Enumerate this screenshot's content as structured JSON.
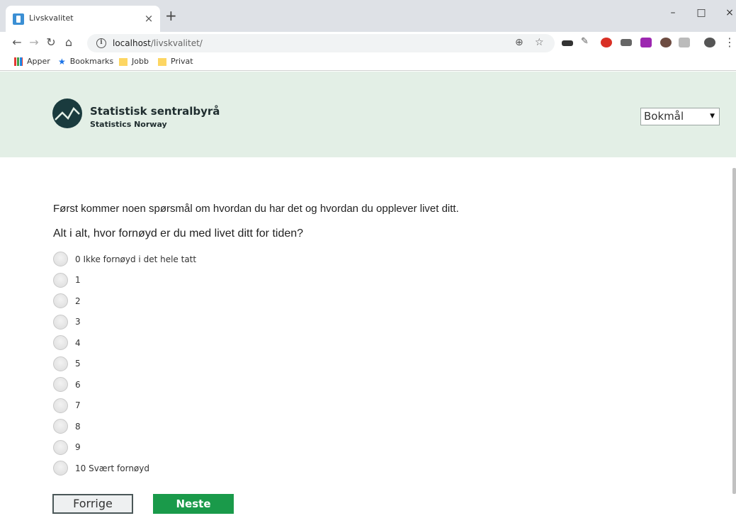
{
  "browser": {
    "tab_title": "Livskvalitet",
    "tab_close": "×",
    "new_tab": "+",
    "url_host": "localhost",
    "url_path": "/livskvalitet/",
    "window": {
      "minimize": "–",
      "maximize": "□",
      "close": "×"
    }
  },
  "bookmarks": [
    {
      "label": "Apper",
      "icon": "apps-grid-icon"
    },
    {
      "label": "Bookmarks",
      "icon": "star-icon"
    },
    {
      "label": "Jobb",
      "icon": "folder-icon"
    },
    {
      "label": "Privat",
      "icon": "folder-icon"
    }
  ],
  "header": {
    "brand": "Statistisk sentralbyrå",
    "brand_sub": "Statistics Norway",
    "language": "Bokmål"
  },
  "survey": {
    "intro": "Først kommer noen spørsmål om hvordan du har det og hvordan du opplever livet ditt.",
    "question": "Alt i alt, hvor fornøyd er du med livet ditt for tiden?",
    "options": [
      "0 Ikke fornøyd i det hele tatt",
      "1",
      "2",
      "3",
      "4",
      "5",
      "6",
      "7",
      "8",
      "9",
      "10 Svært fornøyd"
    ],
    "prev_label": "Forrige",
    "next_label": "Neste"
  },
  "colors": {
    "header_bg": "#e3efe6",
    "next_button": "#1a9a4a",
    "logo": "#1a3b3e"
  }
}
